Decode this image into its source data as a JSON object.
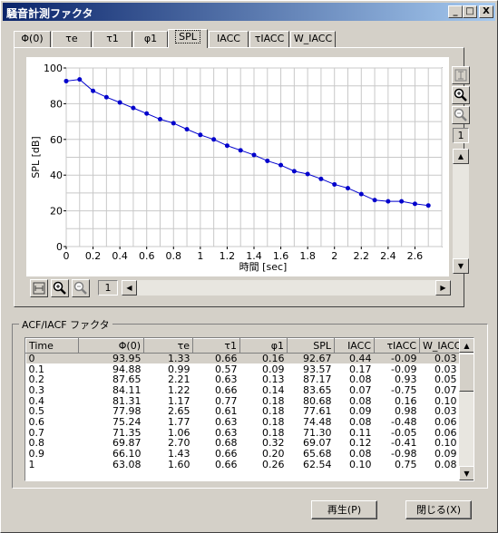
{
  "window": {
    "title": "騒音計測ファクタ"
  },
  "titlebar_buttons": {
    "minimize": "_",
    "maximize": "□",
    "close": "X"
  },
  "tabs": [
    {
      "label": "Φ(0)"
    },
    {
      "label": "τe"
    },
    {
      "label": "τ1"
    },
    {
      "label": "φ1"
    },
    {
      "label": "SPL"
    },
    {
      "label": "IACC"
    },
    {
      "label": "τIACC"
    },
    {
      "label": "W_IACC"
    }
  ],
  "active_tab": "SPL",
  "chart_data": {
    "type": "line",
    "xlabel": "時間 [sec]",
    "ylabel": "SPL [dB]",
    "xlim": [
      0,
      2.8
    ],
    "ylim": [
      0,
      100
    ],
    "xticks": [
      "0",
      "0.2",
      "0.4",
      "0.6",
      "0.8",
      "1",
      "1.2",
      "1.4",
      "1.6",
      "1.8",
      "2",
      "2.2",
      "2.4",
      "2.6"
    ],
    "yticks": [
      "0",
      "20",
      "40",
      "60",
      "80",
      "100"
    ],
    "grid": true,
    "line_color": "#0000cc",
    "x": [
      0,
      0.1,
      0.2,
      0.3,
      0.4,
      0.5,
      0.6,
      0.7,
      0.8,
      0.9,
      1.0,
      1.1,
      1.2,
      1.3,
      1.4,
      1.5,
      1.6,
      1.7,
      1.8,
      1.9,
      2.0,
      2.1,
      2.2,
      2.3,
      2.4,
      2.5,
      2.6,
      2.7
    ],
    "y": [
      92.67,
      93.57,
      87.17,
      83.65,
      80.68,
      77.61,
      74.48,
      71.3,
      69.07,
      65.68,
      62.54,
      60.0,
      56.5,
      53.9,
      51.3,
      48.0,
      45.6,
      42.2,
      40.6,
      37.9,
      34.8,
      32.7,
      29.4,
      26.0,
      25.3,
      25.3,
      23.9,
      23.0
    ]
  },
  "side_tools": {
    "fit": "fit-icon",
    "zoom_in": "zoom-in-icon",
    "zoom_out": "zoom-out-icon",
    "zoom_level": "1"
  },
  "bottom_tools": {
    "zoom_level": "1"
  },
  "group": {
    "label": "ACF/IACF ファクタ"
  },
  "table": {
    "columns": [
      "Time",
      "Φ(0)",
      "τe",
      "τ1",
      "φ1",
      "SPL",
      "IACC",
      "τIACC",
      "W_IACC"
    ],
    "rows": [
      [
        "0",
        "93.95",
        "1.33",
        "0.66",
        "0.16",
        "92.67",
        "0.44",
        "-0.09",
        "0.03"
      ],
      [
        "0.1",
        "94.88",
        "0.99",
        "0.57",
        "0.09",
        "93.57",
        "0.17",
        "-0.09",
        "0.03"
      ],
      [
        "0.2",
        "87.65",
        "2.21",
        "0.63",
        "0.13",
        "87.17",
        "0.08",
        "0.93",
        "0.05"
      ],
      [
        "0.3",
        "84.11",
        "1.22",
        "0.66",
        "0.14",
        "83.65",
        "0.07",
        "-0.75",
        "0.07"
      ],
      [
        "0.4",
        "81.31",
        "1.17",
        "0.77",
        "0.18",
        "80.68",
        "0.08",
        "0.16",
        "0.10"
      ],
      [
        "0.5",
        "77.98",
        "2.65",
        "0.61",
        "0.18",
        "77.61",
        "0.09",
        "0.98",
        "0.03"
      ],
      [
        "0.6",
        "75.24",
        "1.77",
        "0.63",
        "0.18",
        "74.48",
        "0.08",
        "-0.48",
        "0.06"
      ],
      [
        "0.7",
        "71.35",
        "1.06",
        "0.63",
        "0.18",
        "71.30",
        "0.11",
        "-0.05",
        "0.06"
      ],
      [
        "0.8",
        "69.87",
        "2.70",
        "0.68",
        "0.32",
        "69.07",
        "0.12",
        "-0.41",
        "0.10"
      ],
      [
        "0.9",
        "66.10",
        "1.43",
        "0.66",
        "0.20",
        "65.68",
        "0.08",
        "-0.98",
        "0.09"
      ],
      [
        "1",
        "63.08",
        "1.60",
        "0.66",
        "0.26",
        "62.54",
        "0.10",
        "0.75",
        "0.08"
      ]
    ]
  },
  "buttons": {
    "play": "再生(P)",
    "close": "閉じる(X)"
  }
}
